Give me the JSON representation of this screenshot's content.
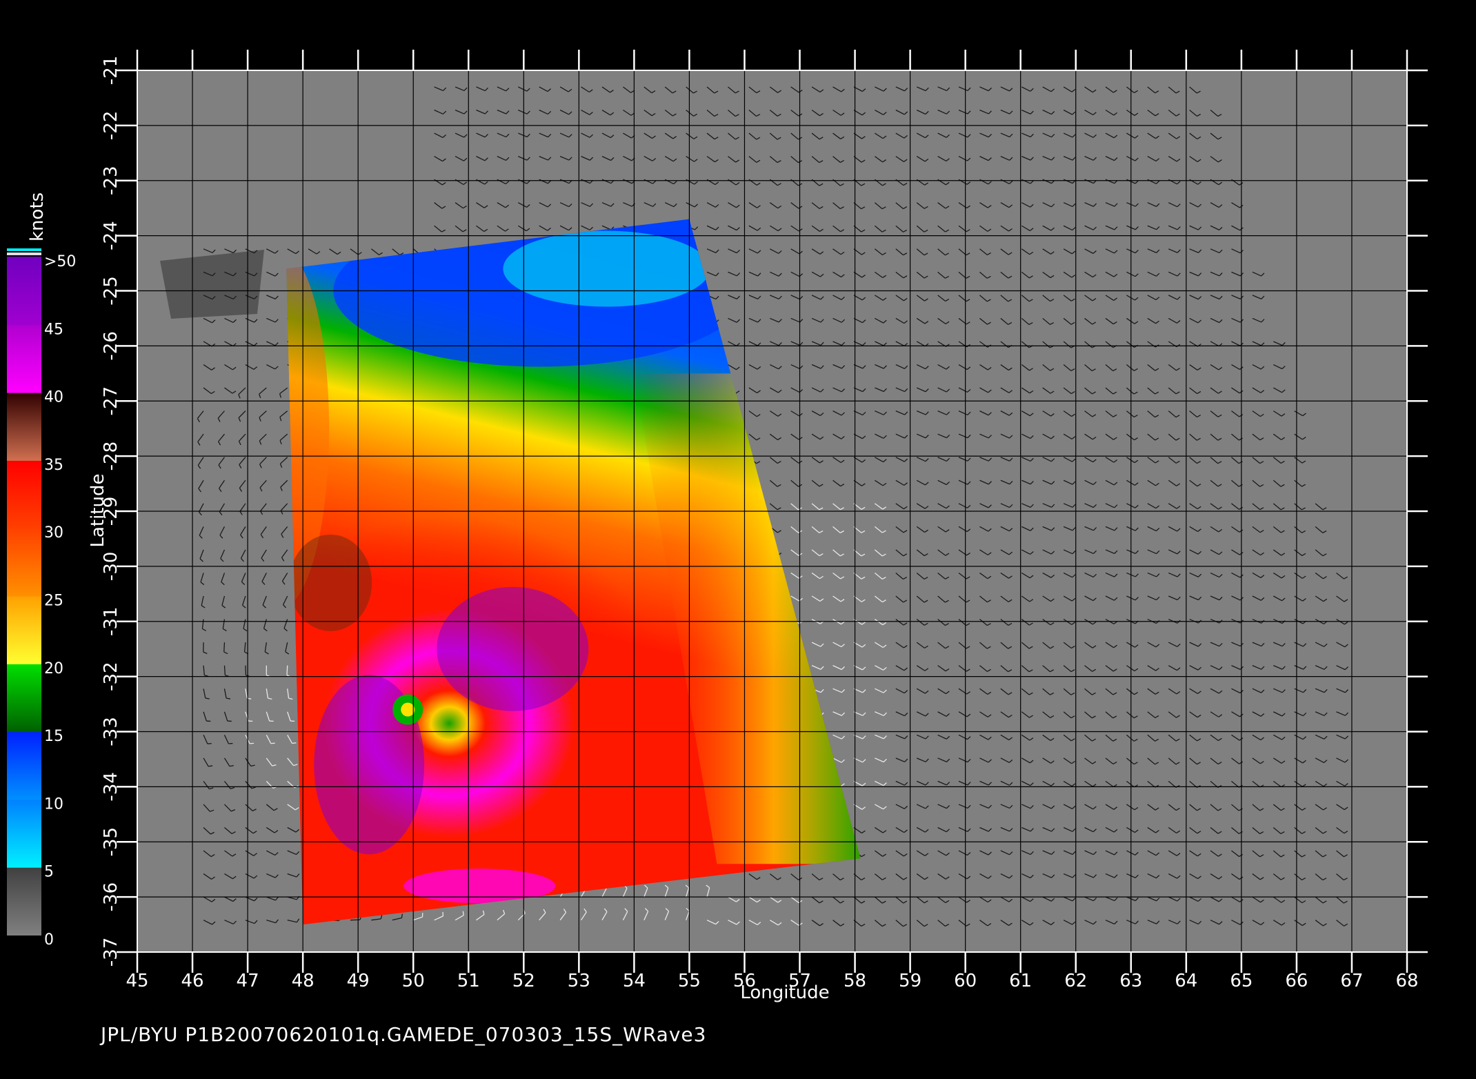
{
  "footer_text": "JPL/BYU  P1B20070620101q.GAMEDE_070303_15S_WRave3",
  "chart_data": {
    "type": "heatmap",
    "xlabel": "Longitude",
    "ylabel": "Latitude",
    "xlim": [
      45,
      68
    ],
    "ylim": [
      -37,
      -21
    ],
    "x_ticks": [
      "45",
      "46",
      "47",
      "48",
      "49",
      "50",
      "51",
      "52",
      "53",
      "54",
      "55",
      "56",
      "57",
      "58",
      "59",
      "60",
      "61",
      "62",
      "63",
      "64",
      "65",
      "66",
      "67",
      "68"
    ],
    "y_ticks": [
      "-21",
      "-22",
      "-23",
      "-24",
      "-25",
      "-26",
      "-27",
      "-28",
      "-29",
      "-30",
      "-31",
      "-32",
      "-33",
      "-34",
      "-35",
      "-36",
      "-37"
    ],
    "grid": true,
    "colorbar": {
      "unit": "knots",
      "labels": [
        "0",
        "5",
        "10",
        "15",
        "20",
        "25",
        "30",
        "35",
        "40",
        "45",
        ">50"
      ],
      "colors": {
        "gray": "#808080",
        "cyan": "#00e8f0",
        "blue": "#0040ff",
        "green": "#00b000",
        "yellow": "#ffe000",
        "orange": "#ff7000",
        "red": "#ff1800",
        "brown": "#6a2a10",
        "magenta": "#ff00ff",
        "purple": "#8800cc"
      }
    },
    "swath_corners": [
      [
        47.7,
        -24.6
      ],
      [
        55.0,
        -23.7
      ],
      [
        58.1,
        -35.3
      ],
      [
        48.0,
        -36.5
      ]
    ],
    "storm_center": [
      49.9,
      -32.6
    ],
    "background": "#808080"
  }
}
